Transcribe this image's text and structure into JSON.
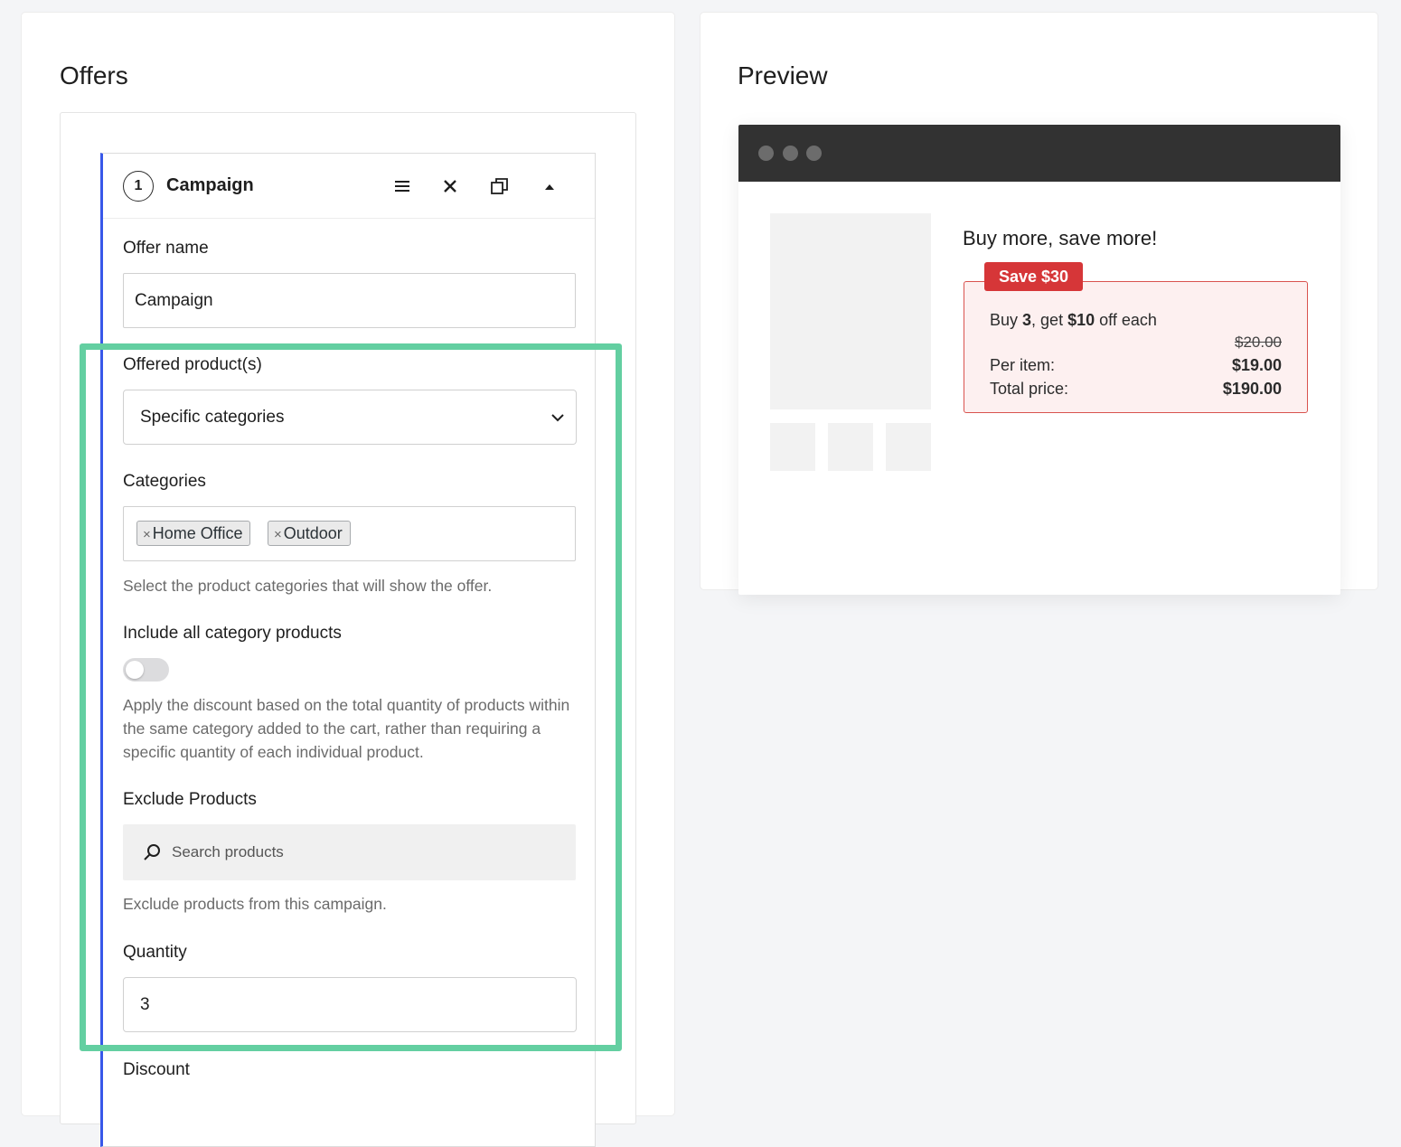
{
  "offers": {
    "title": "Offers",
    "campaign": {
      "step_number": "1",
      "title": "Campaign",
      "offer_name_label": "Offer name",
      "offer_name_value": "Campaign",
      "offered_products_label": "Offered product(s)",
      "offered_products_value": "Specific categories",
      "categories_label": "Categories",
      "categories_tags": [
        "Home Office",
        "Outdoor"
      ],
      "tag_remove_symbol": "×",
      "categories_help": "Select the product categories that will show the offer.",
      "include_all_label": "Include all category products",
      "include_all_enabled": false,
      "include_all_help": "Apply the discount based on the total quantity of products within the same category added to the cart, rather than requiring a specific quantity of each individual product.",
      "exclude_products_label": "Exclude Products",
      "exclude_products_placeholder": "Search products",
      "exclude_products_help": "Exclude products from this campaign.",
      "quantity_label": "Quantity",
      "quantity_value": "3",
      "discount_label": "Discount"
    }
  },
  "preview": {
    "title": "Preview",
    "offer_heading": "Buy more, save more!",
    "save_badge": "Save $30",
    "offer_line_prefix": "Buy ",
    "offer_quantity": "3",
    "offer_line_mid": ", get ",
    "offer_discount": "$10",
    "offer_line_suffix": " off each",
    "old_price": "$20.00",
    "per_item_label": "Per item:",
    "per_item_value": "$19.00",
    "total_label": "Total price:",
    "total_value": "$190.00"
  },
  "colors": {
    "accent_blue": "#3858e9",
    "highlight_green": "#63cfa1",
    "badge_red": "#d63638",
    "browser_bar": "#323232"
  }
}
